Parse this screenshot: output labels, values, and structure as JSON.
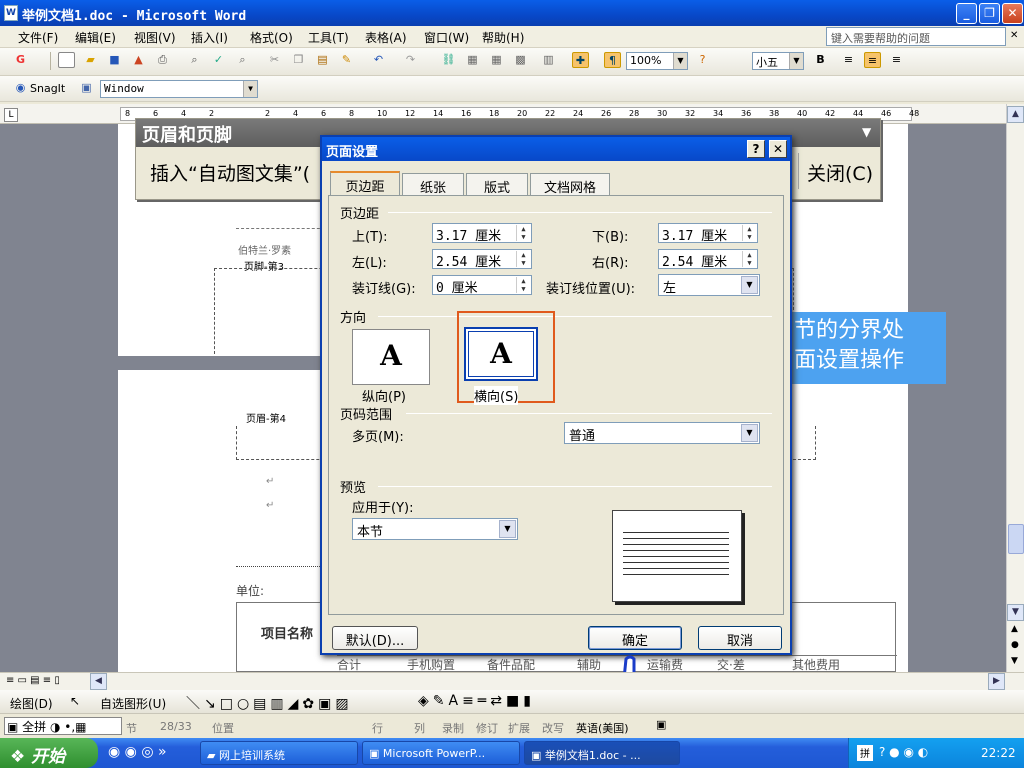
{
  "window": {
    "title": "举例文档1.doc - Microsoft Word",
    "icon": "word-doc-icon"
  },
  "menubar": {
    "items": [
      "文件(F)",
      "编辑(E)",
      "视图(V)",
      "插入(I)",
      "格式(O)",
      "工具(T)",
      "表格(A)",
      "窗口(W)",
      "帮助(H)"
    ],
    "help_placeholder": "键入需要帮助的问题"
  },
  "toolbar": {
    "zoom": "100%",
    "font_size": "小五",
    "bold": "B"
  },
  "snagit": {
    "label": "SnagIt",
    "window_combo": "Window"
  },
  "ruler": {
    "ticks": [
      "8",
      "6",
      "4",
      "2",
      "",
      "2",
      "4",
      "6",
      "8",
      "10",
      "12",
      "14",
      "16",
      "18",
      "20",
      "22",
      "24",
      "26",
      "28",
      "30",
      "32",
      "34",
      "36",
      "38",
      "40",
      "42",
      "44",
      "46",
      "48"
    ]
  },
  "hf_toolbar": {
    "title": "页眉和页脚",
    "insert_autotext": "插入“自动图文集”(",
    "close": "关闭(C)"
  },
  "document": {
    "footer_text": "伯特兰·罗素",
    "footer_label": "页脚-第3",
    "header_label": "页眉-第4",
    "unit_label": "单位:",
    "project_label": "项目名称",
    "table_cells": [
      "合计",
      "手机购置",
      "备件品配",
      "辅助",
      "运输费",
      "交·差",
      "其他费用"
    ],
    "note": "节的分界处\n面设置操作"
  },
  "dialog": {
    "title": "页面设置",
    "tabs": [
      "页边距",
      "纸张",
      "版式",
      "文档网格"
    ],
    "margins_group": "页边距",
    "top_label": "上(T):",
    "top_value": "3.17 厘米",
    "bottom_label": "下(B):",
    "bottom_value": "3.17 厘米",
    "left_label": "左(L):",
    "left_value": "2.54 厘米",
    "right_label": "右(R):",
    "right_value": "2.54 厘米",
    "gutter_label": "装订线(G):",
    "gutter_value": "0 厘米",
    "gutter_pos_label": "装订线位置(U):",
    "gutter_pos_value": "左",
    "orientation_group": "方向",
    "portrait_label": "纵向(P)",
    "landscape_label": "横向(S)",
    "pages_group": "页码范围",
    "multi_pages_label": "多页(M):",
    "multi_pages_value": "普通",
    "preview_group": "预览",
    "apply_to_label": "应用于(Y):",
    "apply_to_value": "本节",
    "default_button": "默认(D)...",
    "ok_button": "确定",
    "cancel_button": "取消"
  },
  "drawbar": {
    "draw": "绘图(D)",
    "autoshapes": "自选图形(U)"
  },
  "statusbar": {
    "section": "节",
    "pages": "28/33",
    "position": "位置",
    "line": "行",
    "col": "列",
    "rec": "录制",
    "trk": "修订",
    "ext": "扩展",
    "ovr": "改写",
    "lang": "英语(美国)"
  },
  "ime": {
    "mode": "全拼"
  },
  "taskbar": {
    "start": "开始",
    "tasks": [
      "网上培训系统",
      "Microsoft PowerP...",
      "举例文档1.doc - ..."
    ],
    "clock": "22:22"
  },
  "colors": {
    "titlebar": "#0a5ee8",
    "highlight": "#e05a1c",
    "note_bg": "#4da2f0"
  }
}
